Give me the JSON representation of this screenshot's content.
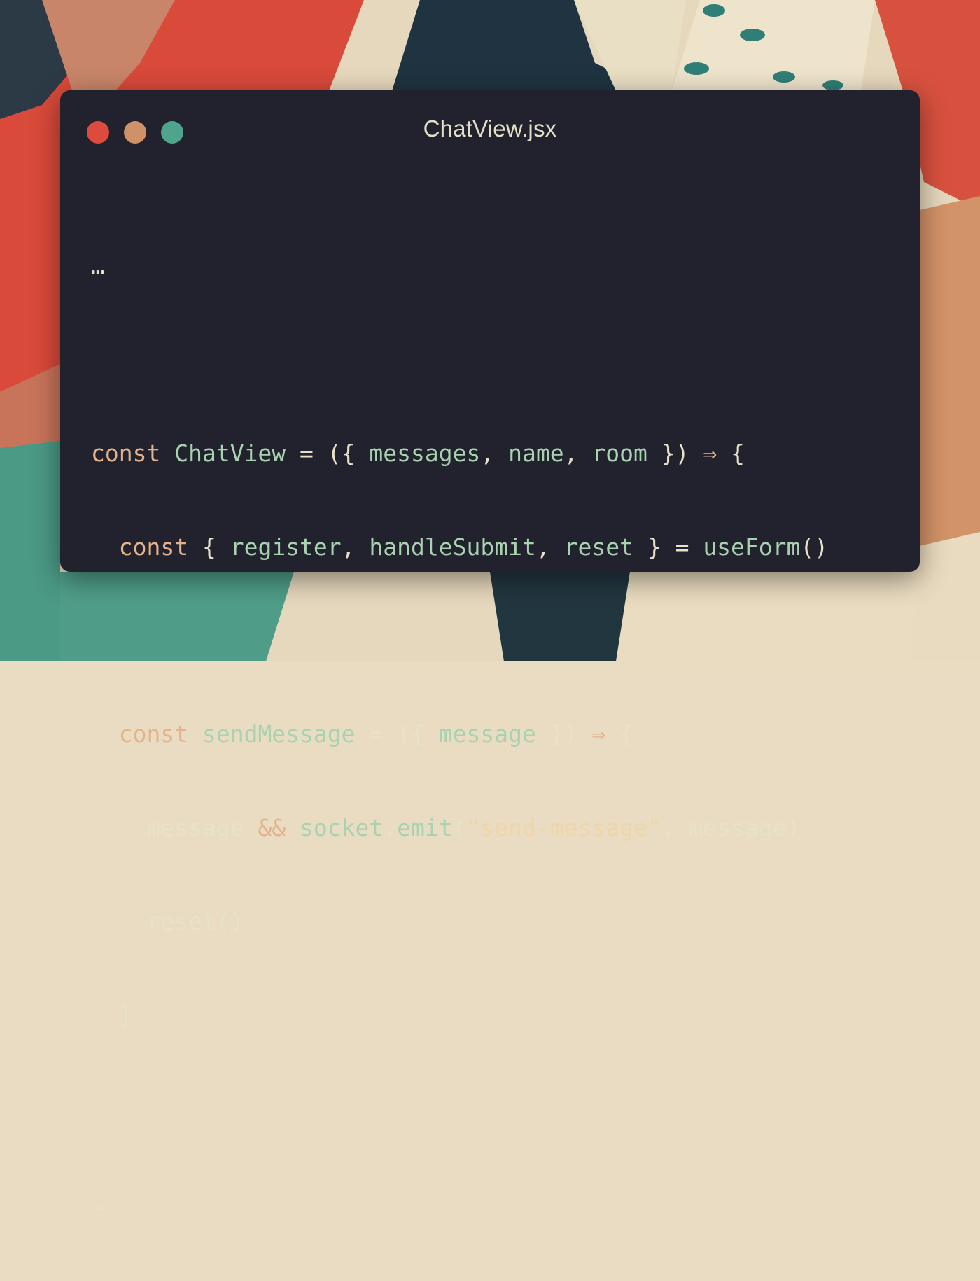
{
  "colors": {
    "window_bg": "#22222f",
    "close": "#dc4b3b",
    "minimize": "#cf9168",
    "maximize": "#4fa58c",
    "keyword": "#e3b48c",
    "identifier": "#a9d2b0",
    "text": "#e8e2c8"
  },
  "window": {
    "title": "ChatView.jsx",
    "controls": [
      {
        "name": "close",
        "icon": "red-dot-icon"
      },
      {
        "name": "minimize",
        "icon": "yellow-dot-icon"
      },
      {
        "name": "maximize",
        "icon": "green-dot-icon"
      }
    ]
  },
  "code": {
    "ellipsis_top": "…",
    "line1": {
      "kw": "const",
      "name": "ChatView",
      "eq": "=",
      "open": "({",
      "p1": "messages",
      "c1": ",",
      "p2": "name",
      "c2": ",",
      "p3": "room",
      "close": "})",
      "arrow": "⇒",
      "brace": "{"
    },
    "line2": {
      "kw": "const",
      "open": "{",
      "p1": "register",
      "c1": ",",
      "p2": "handleSubmit",
      "c2": ",",
      "p3": "reset",
      "close": "}",
      "eq": "=",
      "call": "useForm",
      "parens": "()"
    },
    "line4": {
      "kw": "const",
      "name": "sendMessage",
      "eq": "=",
      "open": "({",
      "p1": "message",
      "close": "})",
      "arrow": "⇒",
      "brace": "{"
    },
    "line5": {
      "v1": "message",
      "op": "&&",
      "obj": "socket",
      "dot": ".",
      "method": "emit",
      "open": "(",
      "str": "\"send-message\"",
      "comma": ",",
      "v2": "message",
      "close": ")"
    },
    "line6": {
      "call": "reset",
      "parens": "()"
    },
    "line7": {
      "brace": "}"
    },
    "ellipsis_bottom": "…"
  }
}
